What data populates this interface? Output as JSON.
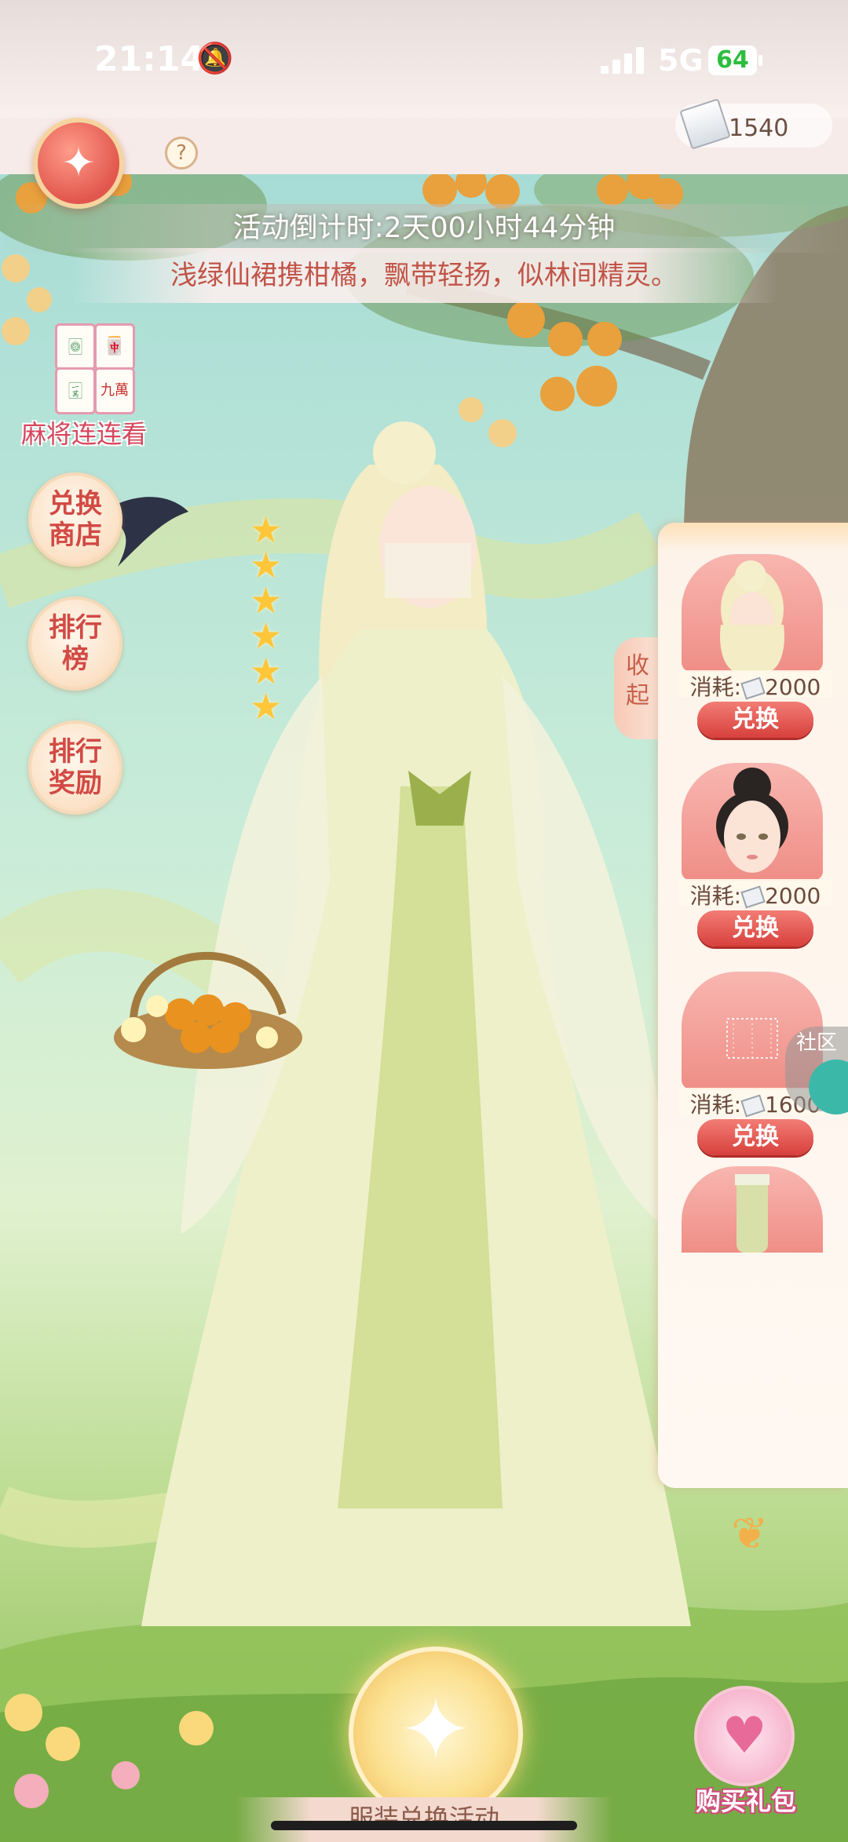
{
  "status_bar": {
    "time": "21:14",
    "network": "5G",
    "battery": "64"
  },
  "header": {
    "currency_amount": "1540"
  },
  "event": {
    "countdown": "活动倒计时:2天00小时44分钟",
    "description": "浅绿仙裙携柑橘，飘带轻扬，似林间精灵。"
  },
  "left_menu": {
    "mahjong_label": "麻将连连看",
    "mahjong_tiles": [
      "🀙",
      "🀇",
      "🀄",
      "九萬"
    ],
    "exchange_shop": "兑换商店",
    "leaderboard": "排行榜",
    "rank_rewards": "排行奖励"
  },
  "stars": {
    "count": 6,
    "max": 6
  },
  "collapse_label": "收起",
  "exchange_items": [
    {
      "cost_label": "消耗:",
      "cost": "2000",
      "button": "兑换"
    },
    {
      "cost_label": "消耗:",
      "cost": "2000",
      "button": "兑换"
    },
    {
      "cost_label": "消耗:",
      "cost": "1600",
      "button": "兑换"
    }
  ],
  "community_label": "社区",
  "bottom": {
    "banner": "服装兑换活动",
    "gift_label": "购买礼包"
  },
  "colors": {
    "accent_red": "#d8403c",
    "panel_bg": "#fdf3e9",
    "star": "#ffc63a"
  }
}
